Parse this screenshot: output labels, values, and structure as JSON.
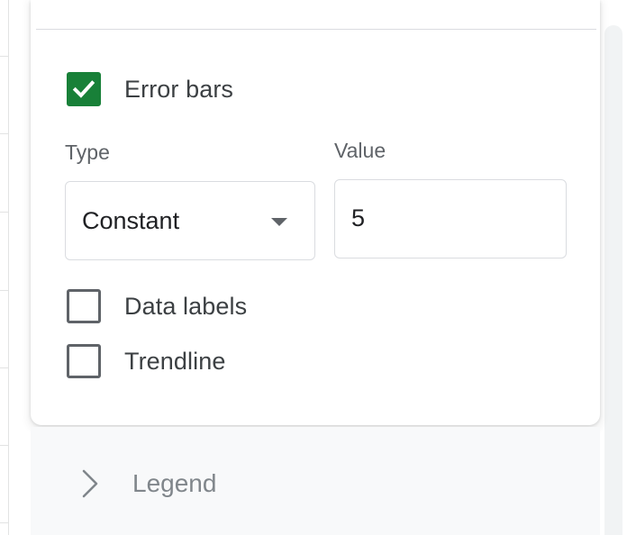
{
  "error_bars": {
    "label": "Error bars",
    "checked": true,
    "type_label": "Type",
    "type_value": "Constant",
    "value_label": "Value",
    "value": "5"
  },
  "data_labels": {
    "label": "Data labels",
    "checked": false
  },
  "trendline": {
    "label": "Trendline",
    "checked": false
  },
  "legend_section": {
    "label": "Legend",
    "expanded": false
  },
  "icons": {
    "checkmark": "check-icon",
    "dropdown": "arrow-drop-down-icon",
    "chevron": "chevron-right-icon"
  },
  "colors": {
    "accent_green": "#188038",
    "text_primary": "#3c4043",
    "text_secondary": "#5f6368",
    "border": "#dadce0",
    "section_bg": "#f8f9fa",
    "legend_text": "#80868b"
  }
}
